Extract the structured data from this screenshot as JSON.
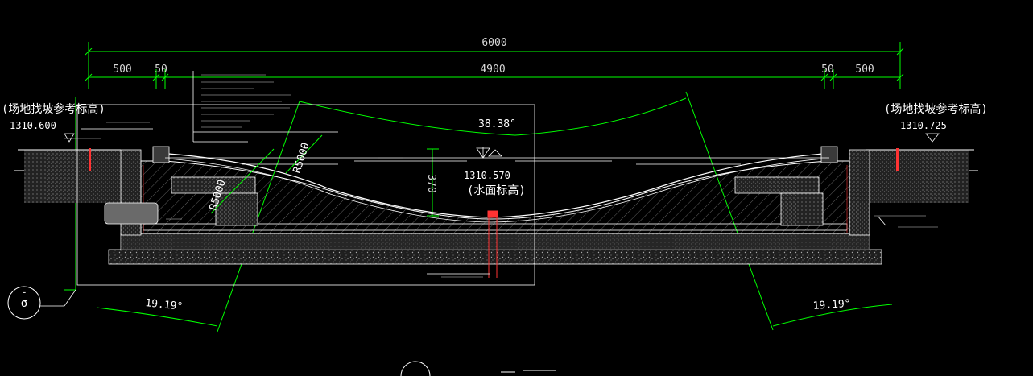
{
  "dimensions": {
    "overall": "6000",
    "left_outer": "500",
    "left_inner": "50",
    "center": "4900",
    "right_inner": "50",
    "right_outer": "500",
    "depth": "370"
  },
  "levels": {
    "left_label": "(场地找坡参考标高)",
    "left_value": "1310.600",
    "right_label": "(场地找坡参考标高)",
    "right_value": "1310.725",
    "water_value": "1310.570",
    "water_label": "(水面标高)"
  },
  "angles": {
    "top": "38.38°",
    "bottom_left": "19.19°",
    "bottom_right": "19.19°"
  },
  "radii": {
    "r1": "R5000",
    "r2": "R5000"
  },
  "section_symbol": {
    "letter": "σ",
    "dash": "-"
  },
  "colors": {
    "background": "#000000",
    "dimension": "#00ff00",
    "structure": "#ffffff",
    "annotation": "#d9d9d9",
    "accent": "#ff3333"
  }
}
